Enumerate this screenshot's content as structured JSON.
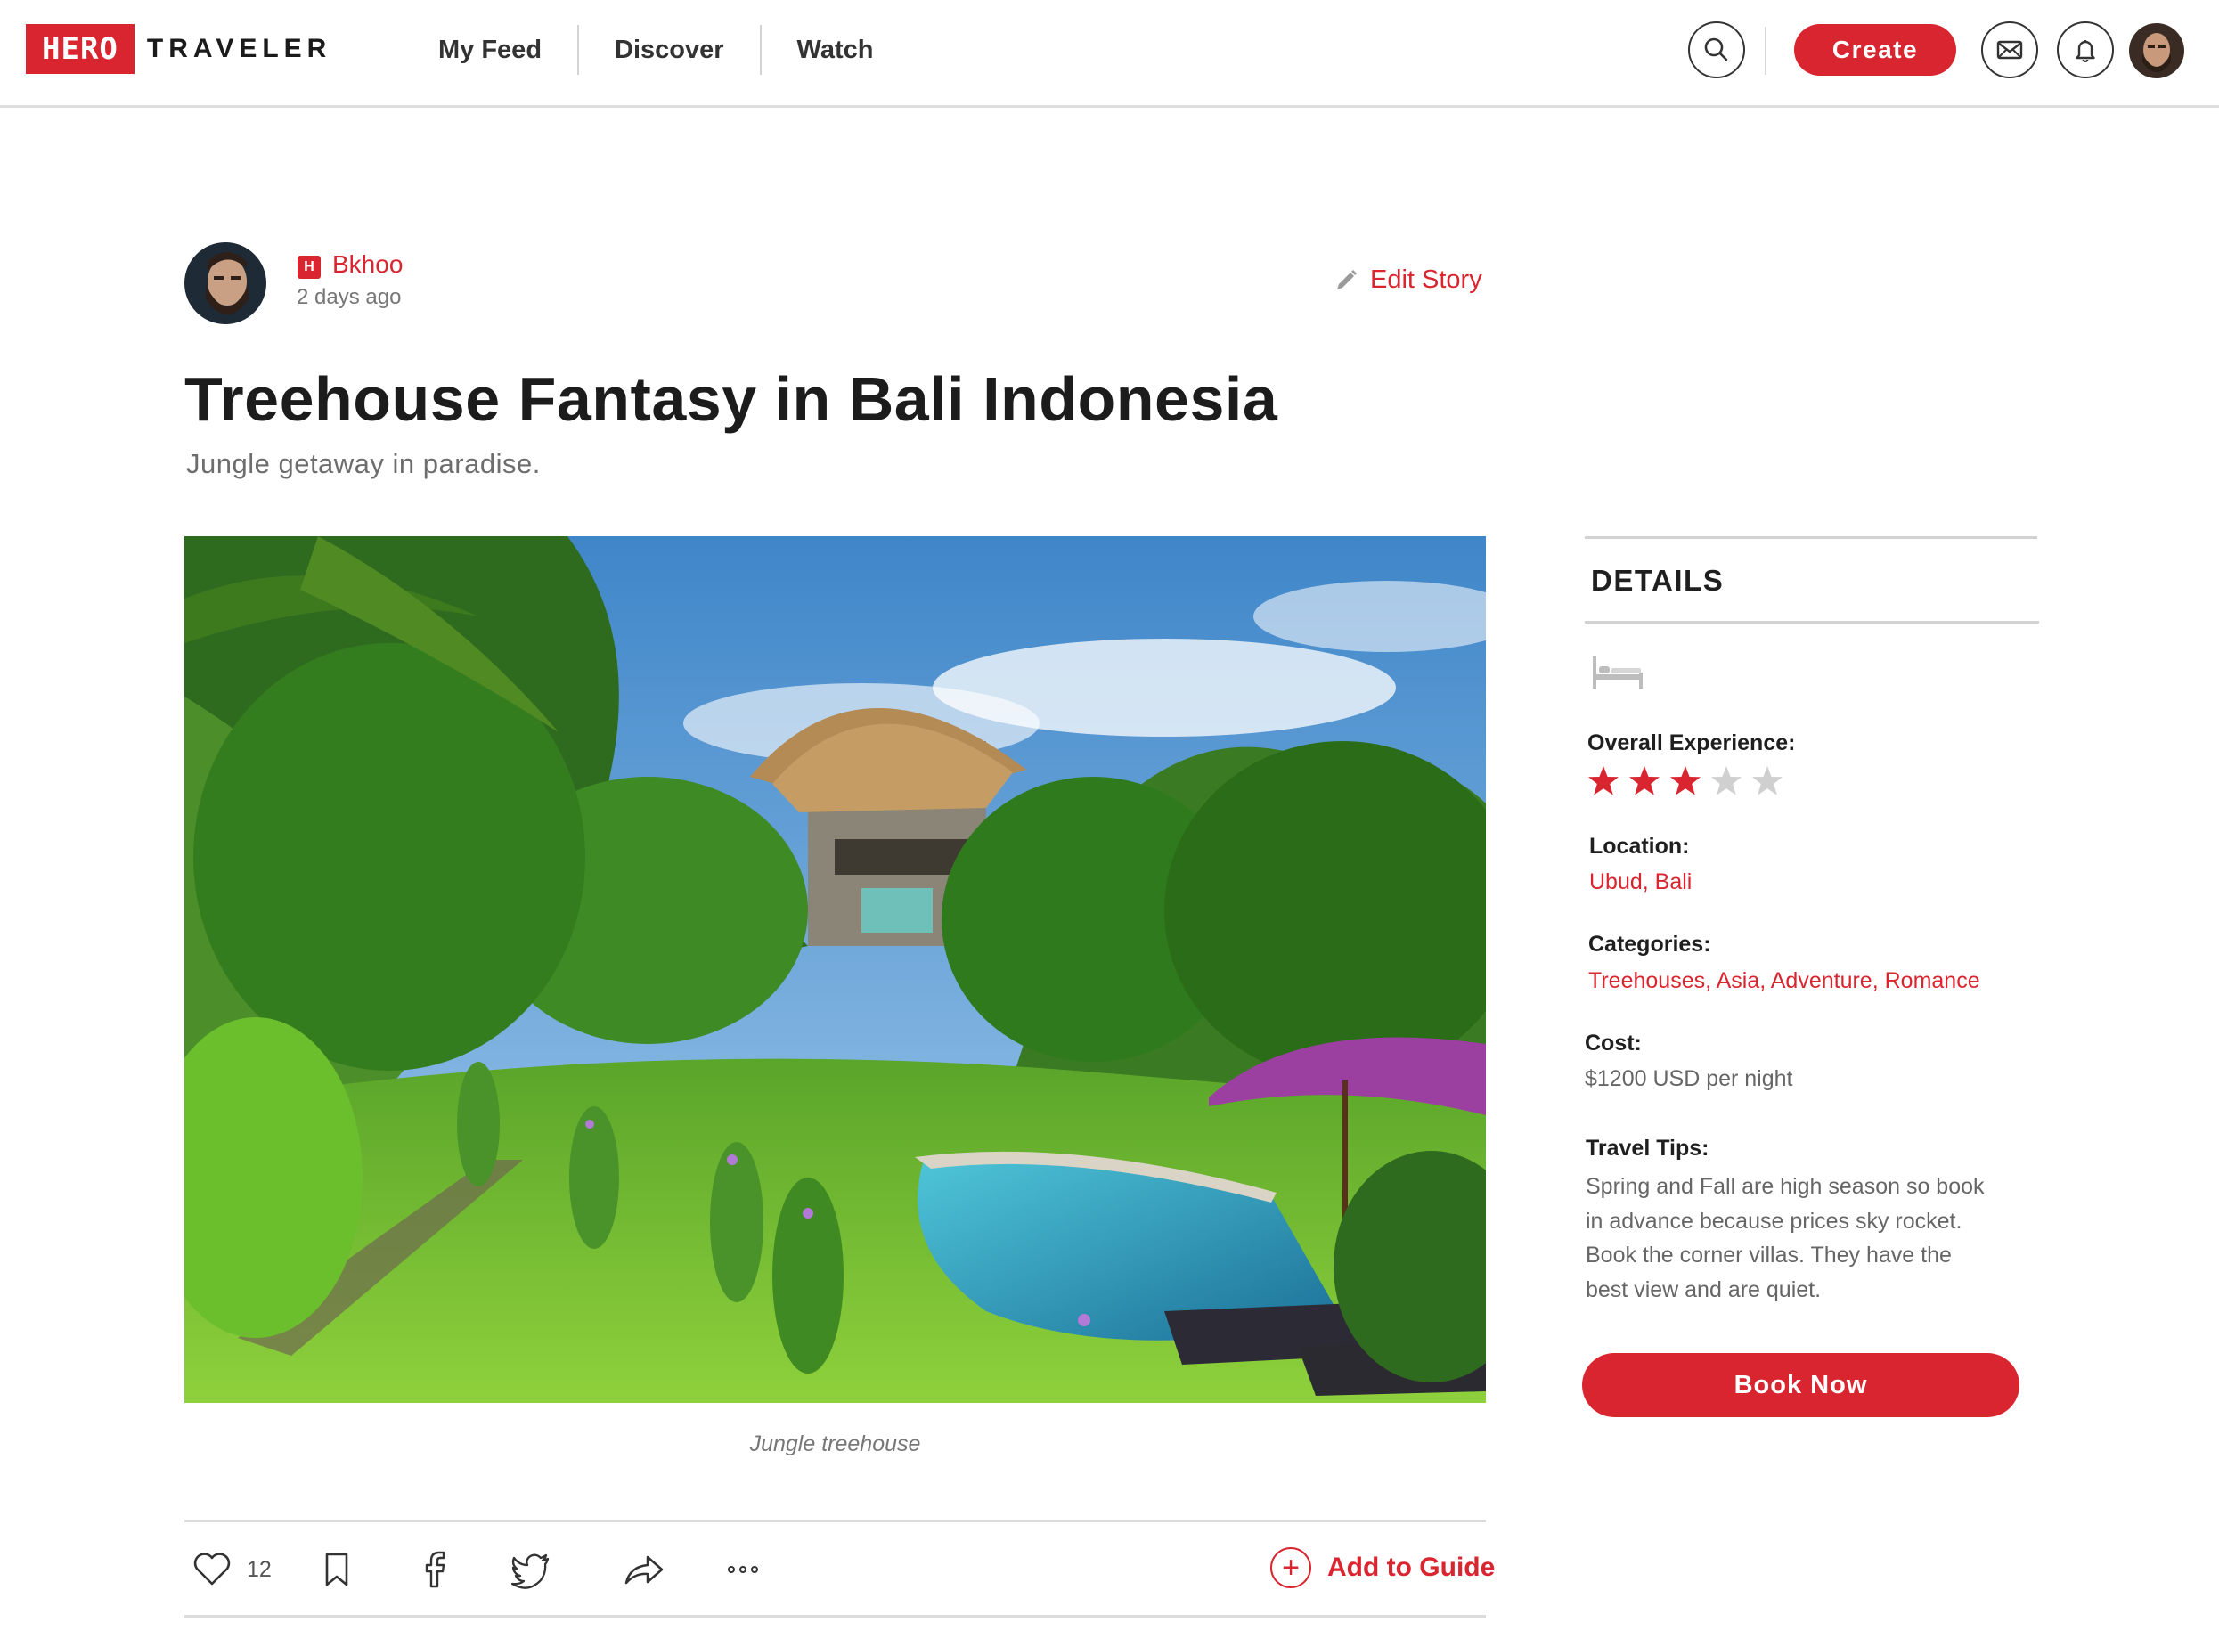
{
  "colors": {
    "accent": "#d9252f",
    "text": "#1f1f1f",
    "muted": "#6d6d6d",
    "divider": "#dcdcdc"
  },
  "header": {
    "logo_box": "HERO",
    "logo_word": "TRAVELER",
    "nav": [
      "My Feed",
      "Discover",
      "Watch"
    ],
    "create_label": "Create",
    "icons": [
      "search-icon",
      "mail-icon",
      "bell-icon",
      "user-avatar"
    ]
  },
  "author": {
    "badge": "H",
    "name": "Bkhoo",
    "time": "2 days ago",
    "edit_label": "Edit Story"
  },
  "story": {
    "title": "Treehouse Fantasy in Bali Indonesia",
    "subtitle": "Jungle getaway in paradise.",
    "caption": "Jungle treehouse"
  },
  "actions": {
    "like_count": "12",
    "add_to_guide": "Add to Guide",
    "icons": [
      "heart-icon",
      "bookmark-icon",
      "facebook-icon",
      "twitter-icon",
      "share-icon",
      "more-icon"
    ]
  },
  "details": {
    "heading": "DETAILS",
    "experience_label": "Overall Experience:",
    "rating": 3,
    "rating_max": 5,
    "location_label": "Location:",
    "location": "Ubud, Bali",
    "categories_label": "Categories:",
    "categories": "Treehouses, Asia, Adventure, Romance",
    "cost_label": "Cost:",
    "cost": "$1200 USD per night",
    "tips_label": "Travel Tips:",
    "tips_lines": [
      "Spring and Fall are high season so book",
      "in advance because prices sky rocket.",
      "Book the corner villas. They have the",
      "best view and are quiet."
    ],
    "book_label": "Book Now"
  }
}
